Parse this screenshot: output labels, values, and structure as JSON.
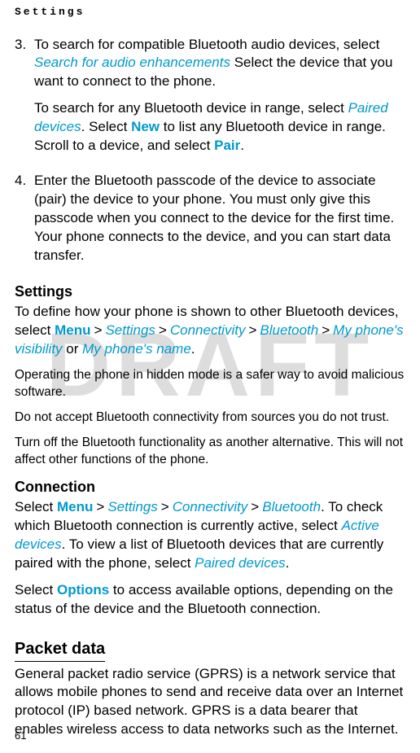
{
  "header": "Settings",
  "watermark": "DRAFT",
  "step3": {
    "num": "3.",
    "p1_a": "To search for compatible Bluetooth audio devices, select ",
    "p1_link1": "Search for audio enhancements",
    "p1_b": " Select the device that you want to connect to the phone.",
    "p2_a": "To search for any Bluetooth device in range, select ",
    "p2_link1": "Paired devices",
    "p2_b": ". Select ",
    "p2_link2": "New",
    "p2_c": " to list any Bluetooth device in range. Scroll to a device, and select ",
    "p2_link3": "Pair",
    "p2_d": "."
  },
  "step4": {
    "num": "4.",
    "p1": "Enter the Bluetooth passcode of the device to associate (pair) the device to your phone. You must only give this passcode when you connect to the device for the first time. Your phone connects to the device, and you can start data transfer."
  },
  "settings": {
    "title": "Settings",
    "p1_a": "To define how your phone is shown to other Bluetooth devices, select ",
    "menu": "Menu",
    "settings_l": "Settings",
    "connectivity": "Connectivity",
    "bluetooth": "Bluetooth",
    "vis": "My phone's visibility",
    "or": " or ",
    "name": "My phone's name",
    "dot": ".",
    "p2": "Operating the phone in hidden mode is a safer way to avoid malicious software.",
    "p3": "Do not accept Bluetooth connectivity from sources you do not trust.",
    "p4": "Turn off the Bluetooth functionality as another alternative. This will not affect other functions of the phone."
  },
  "connection": {
    "title": "Connection",
    "p1_a": "Select ",
    "menu": "Menu",
    "settings_l": "Settings",
    "connectivity": "Connectivity",
    "bluetooth": "Bluetooth",
    "p1_b": ". To check which Bluetooth connection is currently active, select ",
    "active": "Active devices",
    "p1_c": ". To view a list of Bluetooth devices that are currently paired with the phone, select ",
    "paired": "Paired devices",
    "p1_d": ".",
    "p2_a": "Select ",
    "options": "Options",
    "p2_b": " to access available options, depending on the status of the device and the Bluetooth connection."
  },
  "packet": {
    "title": "Packet data",
    "p1": "General packet radio service (GPRS) is a network service that allows mobile phones to send and receive data over an Internet protocol (IP) based network. GPRS is a data bearer that enables wireless access to data networks such as the Internet."
  },
  "gt": ">",
  "pagenum": "61"
}
